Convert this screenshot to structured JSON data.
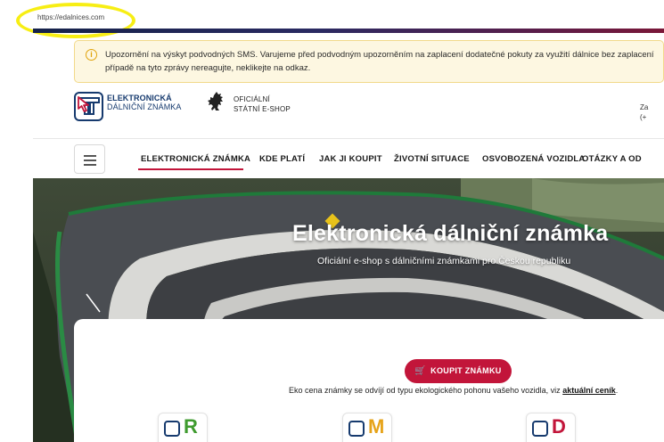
{
  "browser": {
    "url": "https://edalnices.com"
  },
  "alert": {
    "line1": "Upozornění na výskyt podvodných SMS. Varujeme před podvodným upozorněním na zaplacení dodatečné pokuty za využití dálnice bez zaplacení",
    "line2": "případě na tyto zprávy nereagujte, neklikejte na odkaz."
  },
  "header": {
    "logo_line1": "ELEKTRONICKÁ",
    "logo_line2": "DÁLNIČNÍ ZNÁMKA",
    "official_line1": "OFICIÁLNÍ",
    "official_line2": "STÁTNÍ E-SHOP",
    "contact_line1": "Za",
    "contact_line2": "(+"
  },
  "nav": {
    "items": [
      {
        "label": "ELEKTRONICKÁ ZNÁMKA"
      },
      {
        "label": "KDE PLATÍ"
      },
      {
        "label": "JAK JI KOUPIT"
      },
      {
        "label": "ŽIVOTNÍ SITUACE"
      },
      {
        "label": "OSVOBOZENÁ VOZIDLA"
      },
      {
        "label": "OTÁZKY A OD"
      }
    ]
  },
  "hero": {
    "title": "Elektronická dálniční známka",
    "subtitle": "Oficiální e-shop s dálničními známkami pro Českou republiku"
  },
  "cta": {
    "buy_label": "KOUPIT ZNÁMKU",
    "note_text": "Eko cena známky se odvíjí od typu ekologického pohonu vašeho vozidla, viz",
    "note_link": "aktuální ceník",
    "note_end": "."
  },
  "vignette_types": [
    {
      "letter": "R",
      "color": "#3f9b2f"
    },
    {
      "letter": "M",
      "color": "#e6a319"
    },
    {
      "letter": "D",
      "color": "#c2153a"
    }
  ],
  "colors": {
    "accent": "#c2153a",
    "brand": "#163a6e"
  }
}
